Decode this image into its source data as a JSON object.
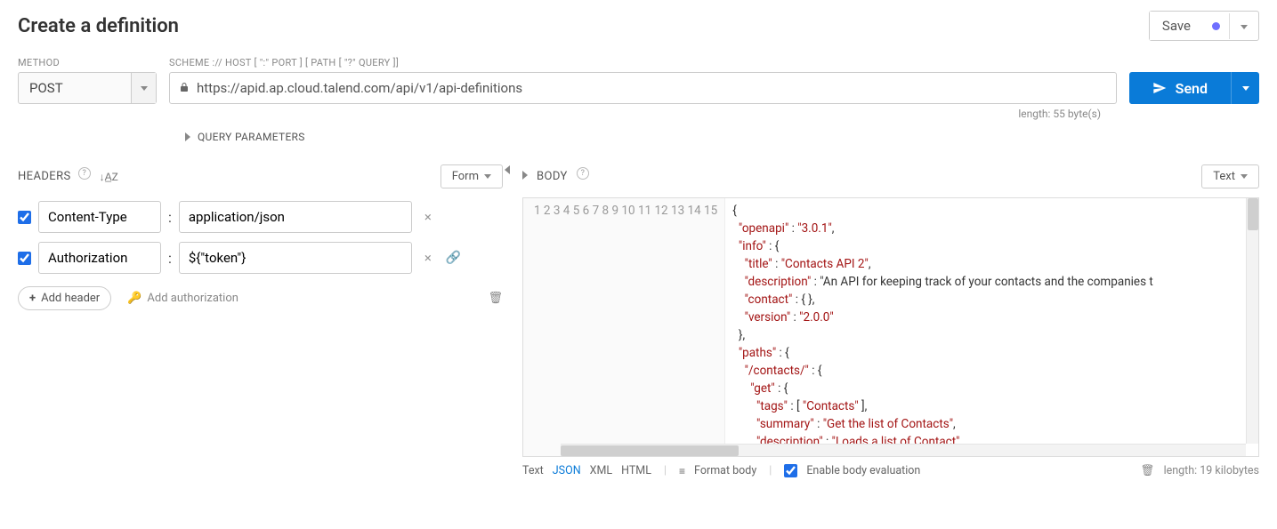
{
  "title": "Create a definition",
  "save": {
    "label": "Save"
  },
  "labels": {
    "method": "METHOD",
    "url": "SCHEME :// HOST [ \":\" PORT ] [ PATH [ \"?\" QUERY ]]"
  },
  "method": "POST",
  "url": "https://apid.ap.cloud.talend.com/api/v1/api-definitions",
  "send": "Send",
  "url_meta": "length: 55 byte(s)",
  "qp": "QUERY PARAMETERS",
  "headers_title": "HEADERS",
  "form_toggle": "Form",
  "headers": [
    {
      "checked": true,
      "key": "Content-Type",
      "value": "application/json",
      "link": false
    },
    {
      "checked": true,
      "key": "Authorization",
      "value": "${\"token\"}",
      "link": true
    }
  ],
  "add_header": "Add header",
  "add_auth": "Add authorization",
  "body_title": "BODY",
  "text_toggle": "Text",
  "code_lines": [
    "{",
    "  \"openapi\" : \"3.0.1\",",
    "  \"info\" : {",
    "    \"title\" : \"Contacts API 2\",",
    "    \"description\" : \"An API for keeping track of your contacts and the companies t",
    "    \"contact\" : { },",
    "    \"version\" : \"2.0.0\"",
    "  },",
    "  \"paths\" : {",
    "    \"/contacts/\" : {",
    "      \"get\" : {",
    "        \"tags\" : [ \"Contacts\" ],",
    "        \"summary\" : \"Get the list of Contacts\",",
    "        \"description\" : \"Loads a list of Contact\",",
    ""
  ],
  "foot": {
    "text": "Text",
    "json": "JSON",
    "xml": "XML",
    "html": "HTML",
    "format": "Format body",
    "enable": "Enable body evaluation",
    "length": "length: 19 kilobytes"
  }
}
